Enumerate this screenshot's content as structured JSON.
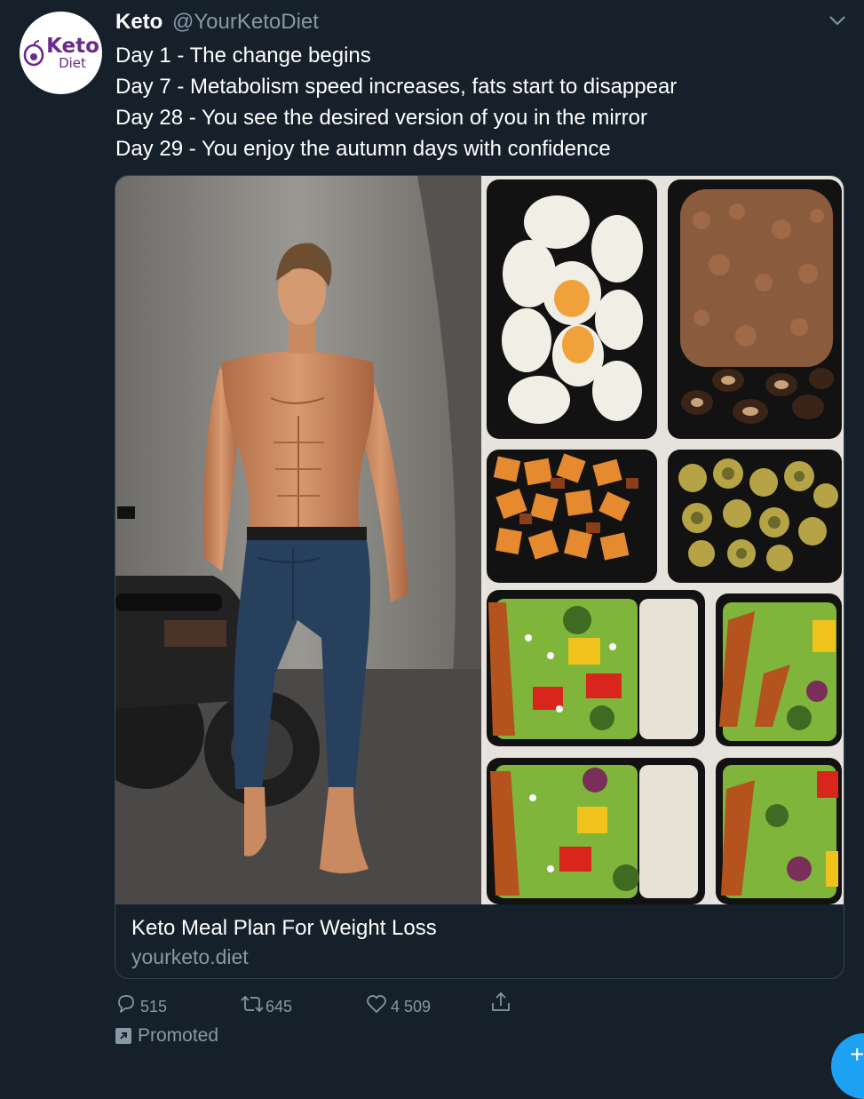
{
  "tweet": {
    "avatar_brand": "Keto",
    "avatar_sub": "Diet",
    "author_name": "Keto",
    "author_handle": "@YourKetoDiet",
    "lines": [
      "Day 1 - The change begins",
      "Day 7 - Metabolism speed increases, fats start to disappear",
      "Day 28 - You see the desired version of you in the mirror",
      "Day 29 - You enjoy the autumn days with confidence"
    ]
  },
  "card": {
    "title": "Keto Meal Plan For Weight Loss",
    "domain": "yourketo.diet",
    "image_left": "shirtless-man-with-motorcycle-photo",
    "image_right": "meal-prep-containers-photo"
  },
  "actions": {
    "reply_count": "515",
    "retweet_count": "645",
    "like_count": "4 509"
  },
  "promoted_label": "Promoted",
  "fab_symbol": "+",
  "icons": {
    "reply": "reply-icon",
    "retweet": "retweet-icon",
    "like": "heart-icon",
    "share": "share-icon",
    "menu": "chevron-down-icon",
    "promoted": "promoted-icon"
  },
  "colors": {
    "background": "#15202b",
    "text": "#ffffff",
    "secondary": "#8899a6",
    "border": "#38444d",
    "accent": "#1da1f2",
    "brand": "#6b2b8c"
  }
}
